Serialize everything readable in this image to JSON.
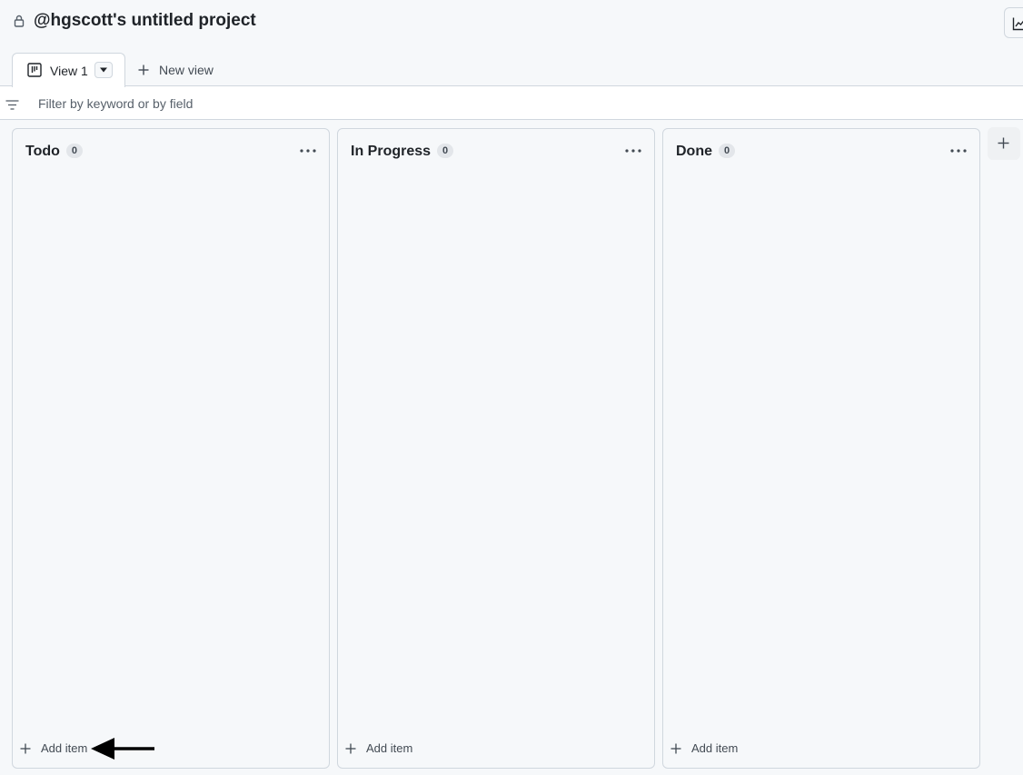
{
  "header": {
    "title": "@hgscott's untitled project",
    "lock_icon": "lock-icon",
    "insights_icon": "graph-icon"
  },
  "tabs": {
    "active": {
      "label": "View 1",
      "icon": "board-icon"
    },
    "new_view_label": "New view"
  },
  "filter": {
    "placeholder": "Filter by keyword or by field",
    "value": ""
  },
  "columns": [
    {
      "title": "Todo",
      "count": "0",
      "add_label": "Add item"
    },
    {
      "title": "In Progress",
      "count": "0",
      "add_label": "Add item"
    },
    {
      "title": "Done",
      "count": "0",
      "add_label": "Add item"
    }
  ],
  "colors": {
    "background": "#f6f8fa",
    "border": "#d0d7de",
    "text": "#1f2328",
    "annotation_arrow": "#000000"
  }
}
